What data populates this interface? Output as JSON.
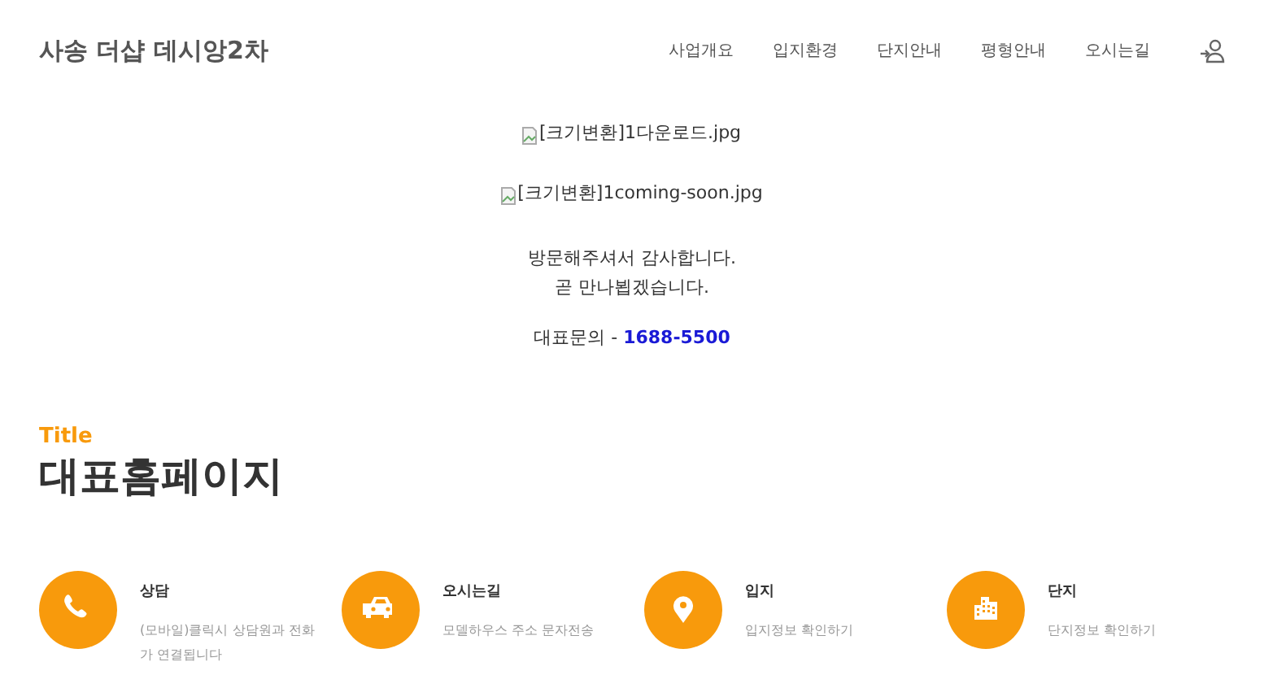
{
  "header": {
    "logo": "사송 더샵 데시앙2차",
    "nav": [
      "사업개요",
      "입지환경",
      "단지안내",
      "평형안내",
      "오시는길"
    ]
  },
  "notice": {
    "images": [
      "[크기변환]1다운로드.jpg",
      "[크기변환]1coming-soon.jpg"
    ],
    "message": [
      "방문해주셔서 감사합니다.",
      "곧 만나뵙겠습니다."
    ],
    "contact_label": "대표문의 -",
    "contact_phone": "1688-5500"
  },
  "section": {
    "eyebrow": "Title",
    "heading": "대표홈페이지"
  },
  "features": [
    {
      "kind": "phone",
      "title": "상담",
      "text": "(모바일)클릭시 상담원과 전화가 연결됩니다"
    },
    {
      "kind": "car",
      "title": "오시는길",
      "text": "모델하우스 주소 문자전송"
    },
    {
      "kind": "pin",
      "title": "입지",
      "text": "입지정보 확인하기"
    },
    {
      "kind": "building",
      "title": "단지",
      "text": "단지정보 확인하기"
    }
  ]
}
